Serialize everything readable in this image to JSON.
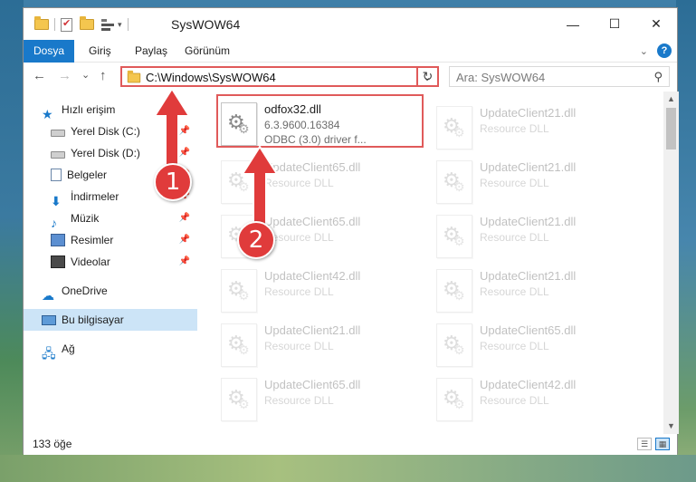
{
  "window": {
    "title": "SysWOW64",
    "controls": {
      "minimize": "—",
      "maximize": "☐",
      "close": "✕"
    }
  },
  "ribbon": {
    "tabs": [
      {
        "label": "Dosya",
        "active": true
      },
      {
        "label": "Giriş"
      },
      {
        "label": "Paylaş"
      },
      {
        "label": "Görünüm"
      }
    ],
    "expand_icon": "chevron-down-icon",
    "help": "?"
  },
  "nav": {
    "back": "←",
    "forward": "→",
    "recent": "⌄",
    "up": "↑",
    "address": "C:\\Windows\\SysWOW64",
    "address_dropdown": "⌄",
    "refresh": "↻",
    "search_placeholder": "Ara: SysWOW64",
    "search_icon": "⚲"
  },
  "sidebar": {
    "items": [
      {
        "label": "Hızlı erişim",
        "icon": "star-icon",
        "pinned": false
      },
      {
        "label": "Yerel Disk (C:)",
        "icon": "drive-icon",
        "pinned": true
      },
      {
        "label": "Yerel Disk (D:)",
        "icon": "drive-icon",
        "pinned": true
      },
      {
        "label": "Belgeler",
        "icon": "documents-icon",
        "pinned": true
      },
      {
        "label": "İndirmeler",
        "icon": "downloads-icon",
        "pinned": true
      },
      {
        "label": "Müzik",
        "icon": "music-icon",
        "pinned": true
      },
      {
        "label": "Resimler",
        "icon": "pictures-icon",
        "pinned": true
      },
      {
        "label": "Videolar",
        "icon": "videos-icon",
        "pinned": true
      },
      {
        "label": "OneDrive",
        "icon": "onedrive-icon",
        "pinned": false
      },
      {
        "label": "Bu bilgisayar",
        "icon": "computer-icon",
        "pinned": false,
        "selected": true
      },
      {
        "label": "Ağ",
        "icon": "network-icon",
        "pinned": false
      }
    ],
    "pin_glyph": "📌"
  },
  "files": [
    {
      "name": "odfox32.dll",
      "line2": "6.3.9600.16384",
      "line3": "ODBC (3.0) driver f...",
      "highlighted": true
    },
    {
      "name": "UpdateClient21.dll",
      "line2": "Resource DLL"
    },
    {
      "name": "UpdateClient65.dll",
      "line2": "Resource DLL"
    },
    {
      "name": "UpdateClient21.dll",
      "line2": "Resource DLL"
    },
    {
      "name": "UpdateClient65.dll",
      "line2": "Resource DLL"
    },
    {
      "name": "UpdateClient21.dll",
      "line2": "Resource DLL"
    },
    {
      "name": "UpdateClient42.dll",
      "line2": "Resource DLL"
    },
    {
      "name": "UpdateClient21.dll",
      "line2": "Resource DLL"
    },
    {
      "name": "UpdateClient21.dll",
      "line2": "Resource DLL"
    },
    {
      "name": "UpdateClient65.dll",
      "line2": "Resource DLL"
    },
    {
      "name": "UpdateClient65.dll",
      "line2": "Resource DLL"
    },
    {
      "name": "UpdateClient21.dll",
      "line2": "Resource DLL"
    },
    {
      "name": "UpdateClient65.dll",
      "line2": "Resource DLL"
    },
    {
      "name": "UpdateClient42.dll",
      "line2": "Resource DLL"
    }
  ],
  "status": {
    "count": "133 öğe"
  },
  "annotations": {
    "badge1": "1",
    "badge2": "2"
  },
  "colors": {
    "accent": "#1979ca",
    "annotation": "#e03b3b",
    "selected": "#cce4f7"
  }
}
